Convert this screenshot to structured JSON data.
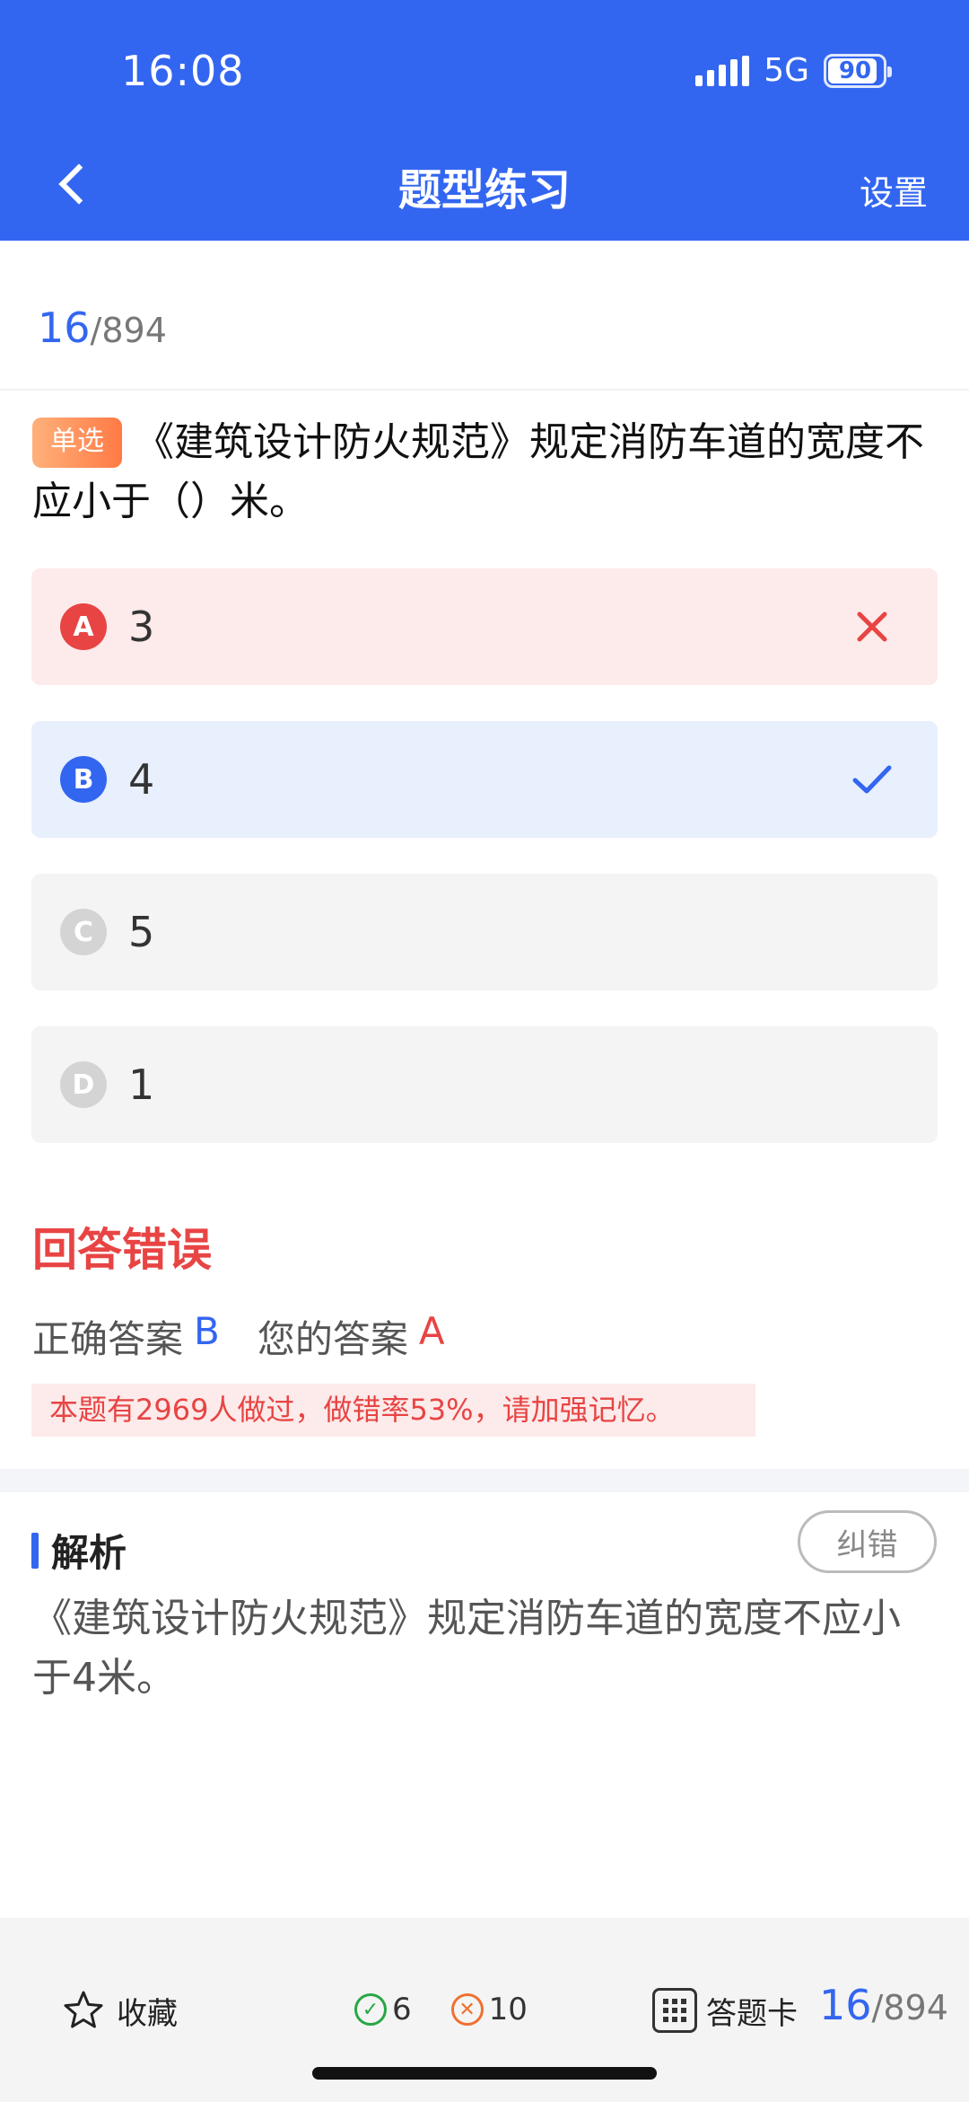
{
  "status": {
    "time": "16:08",
    "network": "5G",
    "battery": "90"
  },
  "nav": {
    "title": "题型练习",
    "settings": "设置"
  },
  "progress": {
    "current": "16",
    "total": "/894"
  },
  "question": {
    "type": "单选",
    "text": "《建筑设计防火规范》规定消防车道的宽度不应小于（）米。"
  },
  "options": [
    {
      "letter": "A",
      "text": "3",
      "state": "wrong"
    },
    {
      "letter": "B",
      "text": "4",
      "state": "correct"
    },
    {
      "letter": "C",
      "text": "5",
      "state": "none"
    },
    {
      "letter": "D",
      "text": "1",
      "state": "none"
    }
  ],
  "result": {
    "title": "回答错误",
    "correct_label": "正确答案",
    "correct_value": "B",
    "yours_label": "您的答案",
    "yours_value": "A",
    "note": "本题有2969人做过，做错率53%，请加强记忆。"
  },
  "analysis": {
    "title": "解析",
    "report_button": "纠错",
    "text": "《建筑设计防火规范》规定消防车道的宽度不应小于4米。"
  },
  "bottom": {
    "favorite": "收藏",
    "correct_count": "6",
    "wrong_count": "10",
    "answer_card": "答题卡",
    "current": "16",
    "total": "/894"
  },
  "colors": {
    "primary": "#3366f0",
    "error": "#e84444",
    "success": "#27a745"
  },
  "icons": {
    "back": "chevron-left-icon",
    "wrong": "close-icon",
    "right": "check-icon",
    "favorite": "star-icon",
    "card": "grid-icon"
  }
}
